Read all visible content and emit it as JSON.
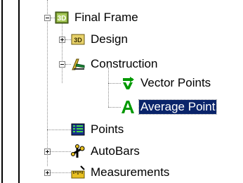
{
  "tree": {
    "nodes": [
      {
        "label": "Final Frame",
        "icon": "3d-assembly-icon",
        "expander": "minus"
      },
      {
        "label": "Design",
        "icon": "3d-design-icon",
        "expander": "plus"
      },
      {
        "label": "Construction",
        "icon": "construction-icon",
        "expander": "minus"
      },
      {
        "label": "Vector Points",
        "icon": "vector-points-icon",
        "expander": "none"
      },
      {
        "label": "Average Point",
        "icon": "average-point-icon",
        "expander": "none",
        "selected": true
      },
      {
        "label": "Points",
        "icon": "points-table-icon",
        "expander": "none"
      },
      {
        "label": "AutoBars",
        "icon": "autobars-icon",
        "expander": "plus"
      },
      {
        "label": "Measurements",
        "icon": "measurements-icon",
        "expander": "plus"
      }
    ]
  },
  "colors": {
    "selection_bg": "#0a246a",
    "selection_fg": "#ffffff",
    "icon_green": "#009900",
    "tree_line": "#8a8a8a"
  }
}
